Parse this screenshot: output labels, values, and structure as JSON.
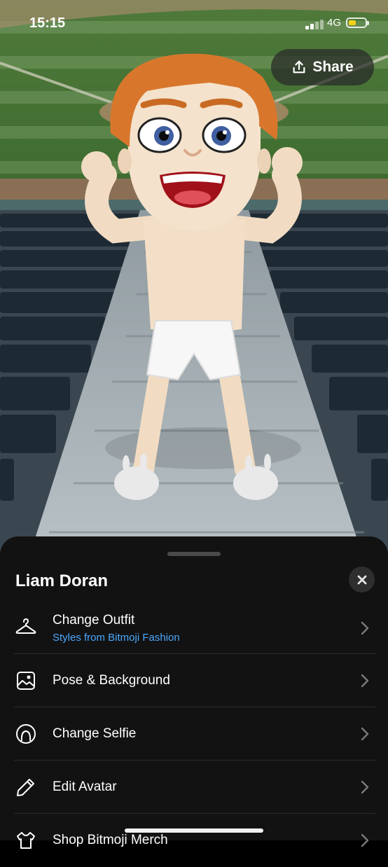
{
  "status_bar": {
    "time": "15:15",
    "network": "4G",
    "battery_level": 0.45
  },
  "share": {
    "label": "Share",
    "icon": "share-upload-icon"
  },
  "sheet": {
    "title": "Liam Doran",
    "close_icon": "close-icon",
    "items": [
      {
        "label": "Change Outfit",
        "sublabel": "Styles from Bitmoji Fashion",
        "icon": "hanger-icon"
      },
      {
        "label": "Pose & Background",
        "icon": "image-icon"
      },
      {
        "label": "Change Selfie",
        "icon": "selfie-icon"
      },
      {
        "label": "Edit Avatar",
        "icon": "pencil-icon"
      },
      {
        "label": "Shop Bitmoji Merch",
        "icon": "merch-icon"
      }
    ]
  },
  "colors": {
    "sheet_bg": "#121212",
    "accent_link": "#4aa8ff",
    "battery": "#f6d21b"
  }
}
